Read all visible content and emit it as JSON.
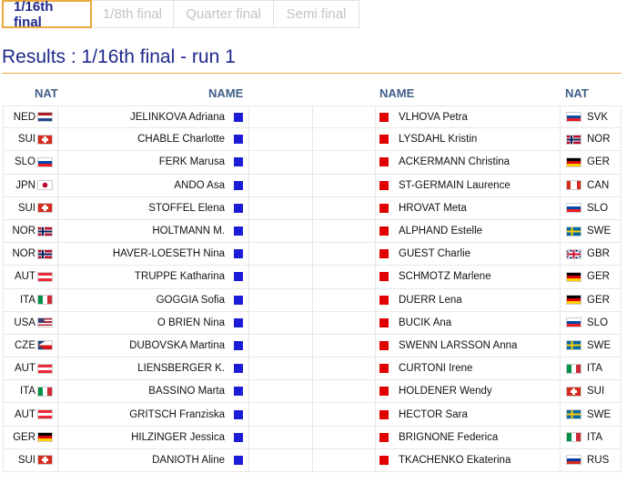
{
  "tabs": [
    {
      "label": "1/16th final",
      "active": true
    },
    {
      "label": "1/8th final",
      "active": false
    },
    {
      "label": "Quarter final",
      "active": false
    },
    {
      "label": "Semi final",
      "active": false
    }
  ],
  "title": "Results : 1/16th final - run 1",
  "headers": {
    "nat_left": "NAT",
    "name_left": "NAME",
    "name_right": "NAME",
    "nat_right": "NAT"
  },
  "colors": {
    "blue_course": "#1c1cd6",
    "red_course": "#e00000",
    "accent": "#e8a93e",
    "title": "#1e2a8c"
  },
  "rows": [
    {
      "l_nat": "NED",
      "l_name": "JELINKOVA Adriana",
      "r_name": "VLHOVA Petra",
      "r_nat": "SVK"
    },
    {
      "l_nat": "SUI",
      "l_name": "CHABLE Charlotte",
      "r_name": "LYSDAHL Kristin",
      "r_nat": "NOR"
    },
    {
      "l_nat": "SLO",
      "l_name": "FERK Marusa",
      "r_name": "ACKERMANN Christina",
      "r_nat": "GER"
    },
    {
      "l_nat": "JPN",
      "l_name": "ANDO Asa",
      "r_name": "ST-GERMAIN Laurence",
      "r_nat": "CAN"
    },
    {
      "l_nat": "SUI",
      "l_name": "STOFFEL Elena",
      "r_name": "HROVAT Meta",
      "r_nat": "SLO"
    },
    {
      "l_nat": "NOR",
      "l_name": "HOLTMANN M.",
      "r_name": "ALPHAND Estelle",
      "r_nat": "SWE"
    },
    {
      "l_nat": "NOR",
      "l_name": "HAVER-LOESETH Nina",
      "r_name": "GUEST Charlie",
      "r_nat": "GBR"
    },
    {
      "l_nat": "AUT",
      "l_name": "TRUPPE Katharina",
      "r_name": "SCHMOTZ Marlene",
      "r_nat": "GER"
    },
    {
      "l_nat": "ITA",
      "l_name": "GOGGIA Sofia",
      "r_name": "DUERR Lena",
      "r_nat": "GER"
    },
    {
      "l_nat": "USA",
      "l_name": "O BRIEN Nina",
      "r_name": "BUCIK Ana",
      "r_nat": "SLO"
    },
    {
      "l_nat": "CZE",
      "l_name": "DUBOVSKA Martina",
      "r_name": "SWENN LARSSON Anna",
      "r_nat": "SWE"
    },
    {
      "l_nat": "AUT",
      "l_name": "LIENSBERGER K.",
      "r_name": "CURTONI Irene",
      "r_nat": "ITA"
    },
    {
      "l_nat": "ITA",
      "l_name": "BASSINO Marta",
      "r_name": "HOLDENER Wendy",
      "r_nat": "SUI"
    },
    {
      "l_nat": "AUT",
      "l_name": "GRITSCH Franziska",
      "r_name": "HECTOR Sara",
      "r_nat": "SWE"
    },
    {
      "l_nat": "GER",
      "l_name": "HILZINGER Jessica",
      "r_name": "BRIGNONE Federica",
      "r_nat": "ITA"
    },
    {
      "l_nat": "SUI",
      "l_name": "DANIOTH Aline",
      "r_name": "TKACHENKO Ekaterina",
      "r_nat": "RUS"
    }
  ]
}
